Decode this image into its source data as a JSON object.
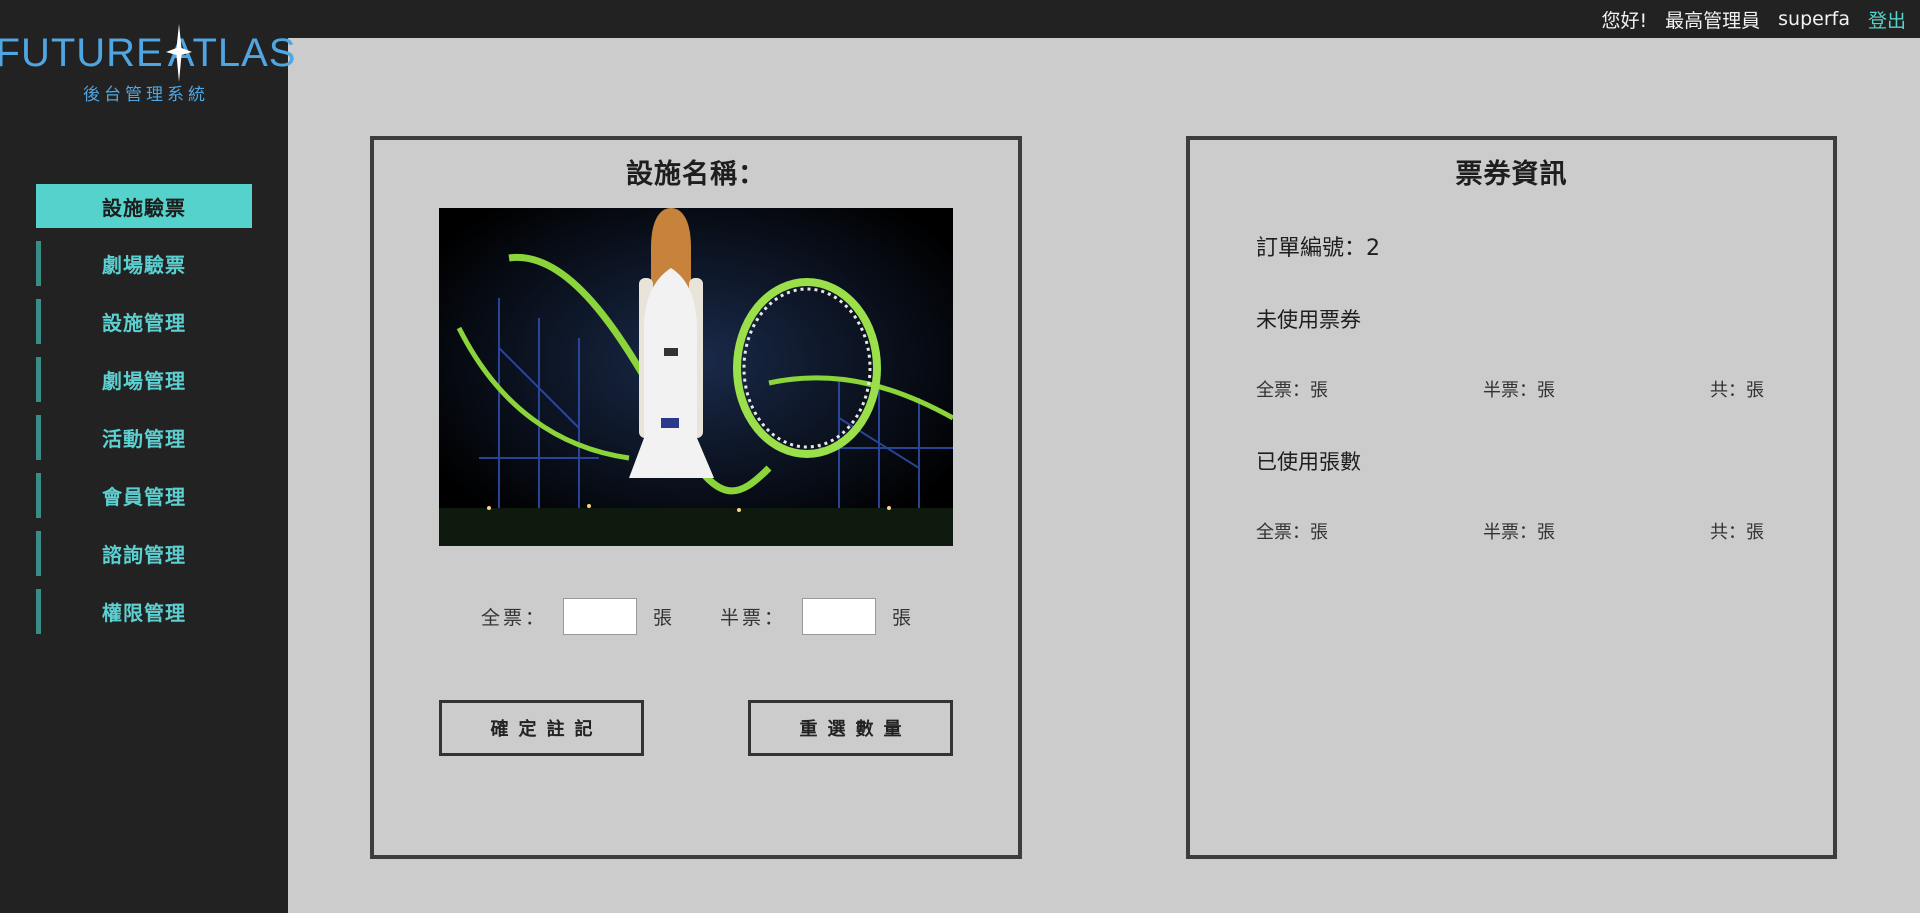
{
  "app": {
    "logo_title_left": "FUTURE",
    "logo_title_right": "ATLAS",
    "logo_subtitle": "後台管理系統"
  },
  "topbar": {
    "greeting": "您好!",
    "role": "最高管理員",
    "username": "superfa",
    "logout_label": "登出"
  },
  "sidebar": {
    "items": [
      {
        "label": "設施驗票",
        "active": true
      },
      {
        "label": "劇場驗票"
      },
      {
        "label": "設施管理"
      },
      {
        "label": "劇場管理"
      },
      {
        "label": "活動管理"
      },
      {
        "label": "會員管理"
      },
      {
        "label": "諮詢管理"
      },
      {
        "label": "權限管理"
      }
    ]
  },
  "facility_panel": {
    "title": "設施名稱：",
    "full_ticket_label": "全票：",
    "half_ticket_label": "半票：",
    "unit": "張",
    "full_ticket_value": "",
    "half_ticket_value": "",
    "confirm_button": "確定註記",
    "reset_button": "重選數量"
  },
  "ticket_panel": {
    "title": "票券資訊",
    "order_number": "訂單編號：2",
    "unused_title": "未使用票券",
    "used_title": "已使用張數",
    "unused": {
      "full": "全票：張",
      "half": "半票：張",
      "total": "共：張"
    },
    "used": {
      "full": "全票：張",
      "half": "半票：張",
      "total": "共：張"
    }
  },
  "colors": {
    "accent": "#55d2cb",
    "logo": "#4fa6e2",
    "sidebar_bg": "#222222",
    "page_bg": "#cccccc"
  }
}
